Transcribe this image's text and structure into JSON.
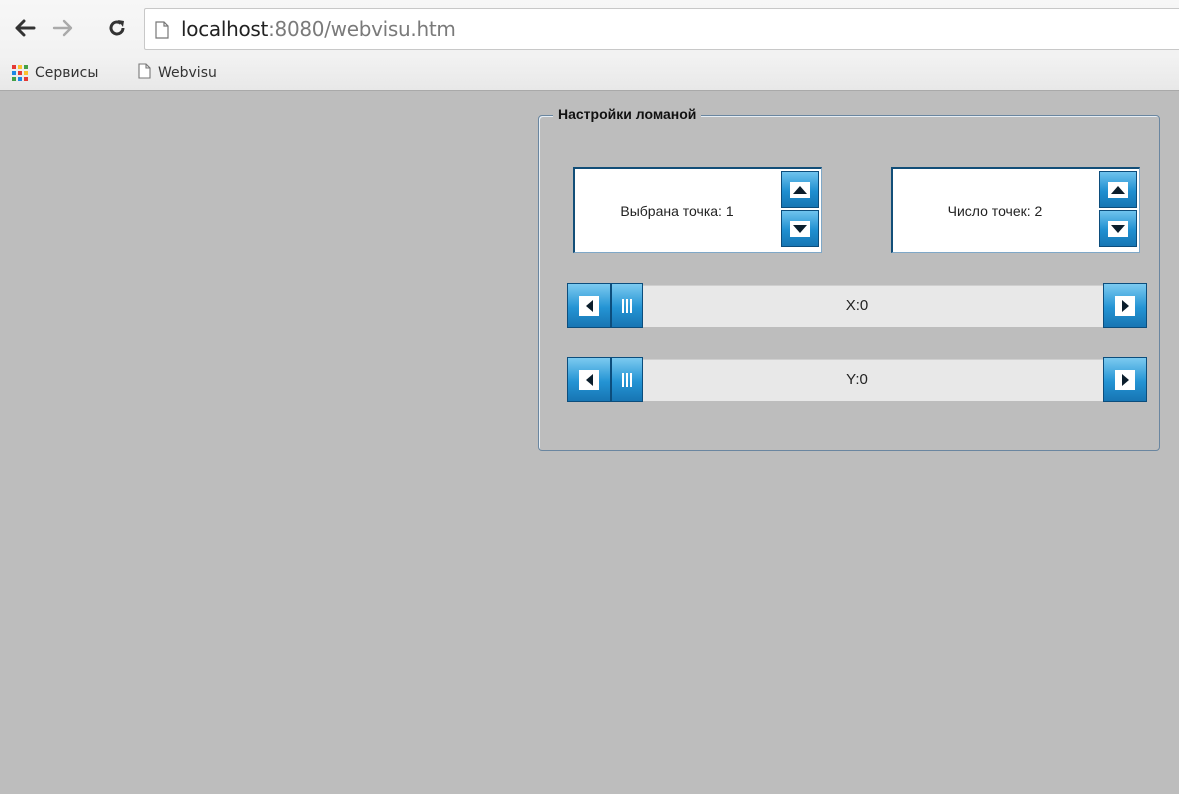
{
  "browser": {
    "url_host": "localhost",
    "url_rest": ":8080/webvisu.htm",
    "bookmarks": [
      {
        "label": "Сервисы",
        "icon": "apps-grid-icon"
      },
      {
        "label": "Webvisu",
        "icon": "page-icon"
      }
    ]
  },
  "panel": {
    "legend": "Настройки ломаной",
    "selected_point_label": "Выбрана точка: 1",
    "point_count_label": "Число точек: 2",
    "x_slider": {
      "label": "X:0",
      "position": 0
    },
    "y_slider": {
      "label": "Y:0",
      "position": 0
    }
  },
  "colors": {
    "page_bg": "#bdbdbd",
    "button_blue": "#1f8fd0",
    "border_dark_blue": "#124e78"
  }
}
